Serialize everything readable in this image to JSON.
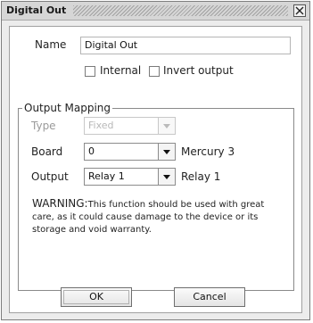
{
  "window": {
    "title": "Digital Out"
  },
  "form": {
    "name_label": "Name",
    "name_value": "Digital Out",
    "internal_label": "Internal",
    "internal_checked": false,
    "invert_label": "Invert output",
    "invert_checked": false
  },
  "mapping": {
    "group_title": "Output Mapping",
    "type_label": "Type",
    "type_value": "Fixed",
    "board_label": "Board",
    "board_value": "0",
    "board_suffix": "Mercury 3",
    "output_label": "Output",
    "output_value": "Relay 1",
    "output_suffix": "Relay 1",
    "warning_head": "WARNING:",
    "warning_text": "This function should be used with great care, as it could cause damage to the device or its storage and void warranty."
  },
  "buttons": {
    "ok": "OK",
    "cancel": "Cancel"
  }
}
